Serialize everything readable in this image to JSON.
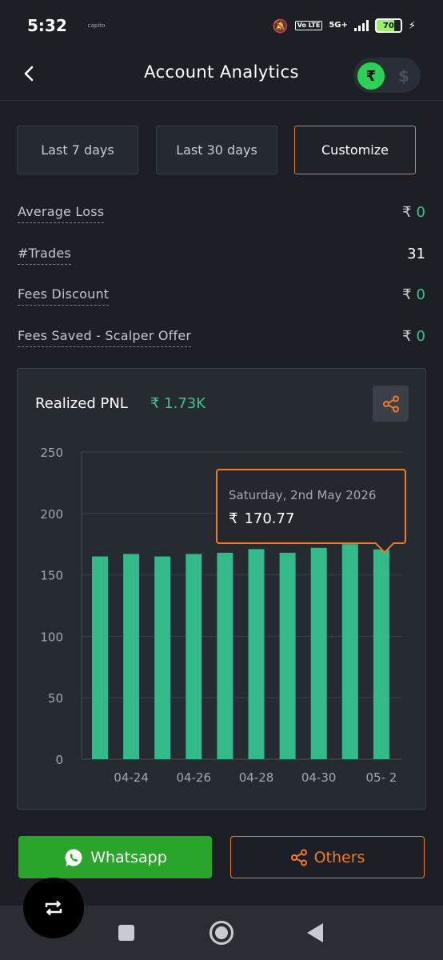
{
  "status_bar": {
    "time": "5:32",
    "app_indicator": "capito",
    "network": "5G+",
    "volte": "Vo LTE",
    "battery": "70"
  },
  "header": {
    "title": "Account Analytics",
    "currency_inr": "₹",
    "currency_usd": "$",
    "selected_currency": "INR"
  },
  "filters": [
    {
      "label": "Last 7 days",
      "active": false
    },
    {
      "label": "Last 30 days",
      "active": false
    },
    {
      "label": "Customize",
      "active": true
    }
  ],
  "metrics": [
    {
      "label": "Average Loss",
      "currency": "₹",
      "value": "0"
    },
    {
      "label": "#Trades",
      "currency": "",
      "value": "31"
    },
    {
      "label": "Fees Discount",
      "currency": "₹",
      "value": "0"
    },
    {
      "label": "Fees Saved - Scalper Offer",
      "currency": "₹",
      "value": "0"
    }
  ],
  "chart_card": {
    "title": "Realized PNL",
    "pnl_value": "₹ 1.73K"
  },
  "chart_data": {
    "type": "bar",
    "ylim": [
      0,
      250
    ],
    "yticks": [
      0,
      50,
      100,
      150,
      200,
      250
    ],
    "x_tick_labels": [
      "04-24",
      "04-26",
      "04-28",
      "04-30",
      "05- 2"
    ],
    "x_tick_indices": [
      1,
      3,
      5,
      7,
      9
    ],
    "values": [
      165,
      167,
      165,
      167,
      168,
      171,
      168,
      172,
      175,
      170.77
    ],
    "bar_color": "#33b98a",
    "grid": true
  },
  "tooltip": {
    "date": "Saturday, 2nd May 2026",
    "currency": "₹",
    "value": "170.77"
  },
  "share": {
    "whatsapp_label": "Whatsapp",
    "others_label": "Others"
  },
  "colors": {
    "accent": "#f07b2c",
    "positive": "#3cc48c",
    "whatsapp": "#2aa52c",
    "background": "#1c1f26"
  }
}
